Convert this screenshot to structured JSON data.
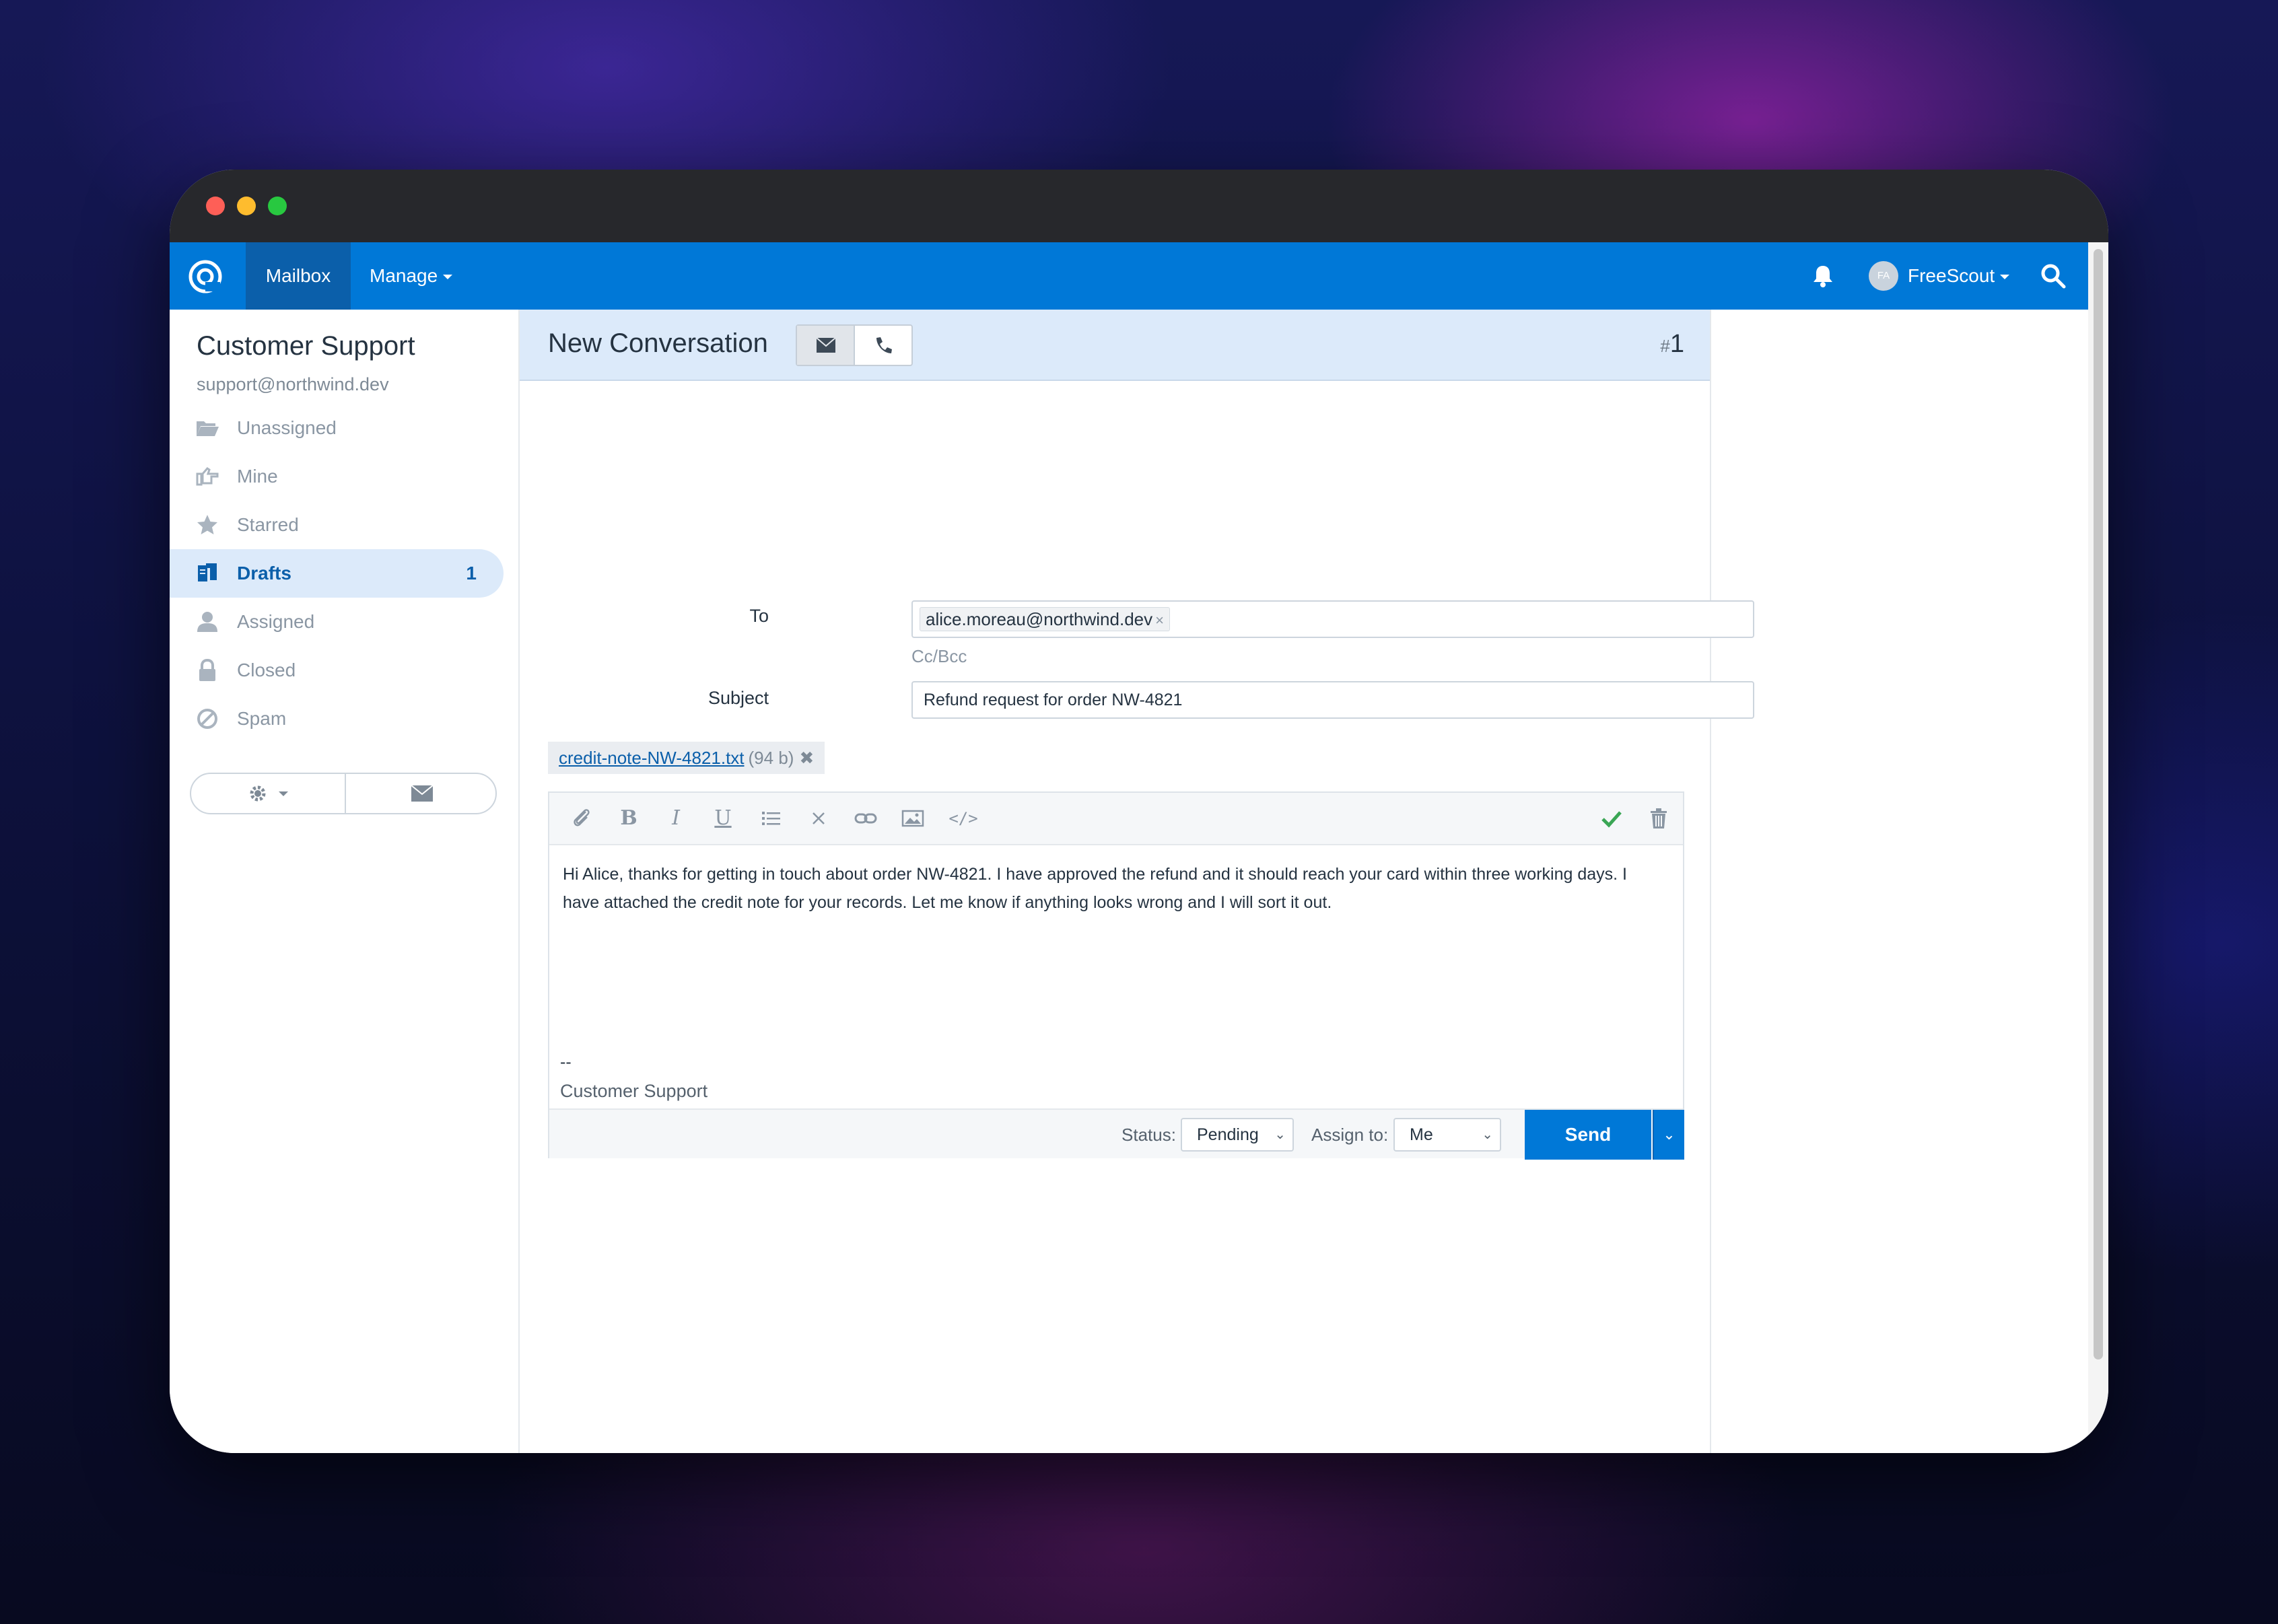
{
  "navbar": {
    "mailbox_label": "Mailbox",
    "manage_label": "Manage",
    "avatar_initials": "FA",
    "user_name": "FreeScout"
  },
  "sidebar": {
    "mailbox_name": "Customer Support",
    "mailbox_email": "support@northwind.dev",
    "folders": [
      {
        "label": "Unassigned",
        "icon": "folder-open-icon"
      },
      {
        "label": "Mine",
        "icon": "hand-point-icon"
      },
      {
        "label": "Starred",
        "icon": "star-icon"
      },
      {
        "label": "Drafts",
        "icon": "drafts-icon",
        "count": "1",
        "active": true
      },
      {
        "label": "Assigned",
        "icon": "user-icon"
      },
      {
        "label": "Closed",
        "icon": "lock-icon"
      },
      {
        "label": "Spam",
        "icon": "ban-icon"
      }
    ]
  },
  "conversation": {
    "title": "New Conversation",
    "number_hash": "#",
    "number": "1",
    "to_label": "To",
    "to_recipient": "alice.moreau@northwind.dev",
    "cc_bcc_label": "Cc/Bcc",
    "subject_label": "Subject",
    "subject_value": "Refund request for order NW-4821",
    "attachment": {
      "name": "credit-note-NW-4821.txt",
      "size": "(94 b)"
    },
    "body": "Hi Alice, thanks for getting in touch about order NW-4821. I have approved the refund and it should reach your card within three working days. I have attached the credit note for your records. Let me know if anything looks wrong and I will sort it out.",
    "signature_dash": "--",
    "signature_name": "Customer Support",
    "status_label": "Status:",
    "status_value": "Pending",
    "assign_label": "Assign to:",
    "assign_value": "Me",
    "send_label": "Send"
  },
  "colors": {
    "brand": "#0078d7",
    "active_folder_bg": "#dceafa",
    "check_green": "#3aa655"
  }
}
